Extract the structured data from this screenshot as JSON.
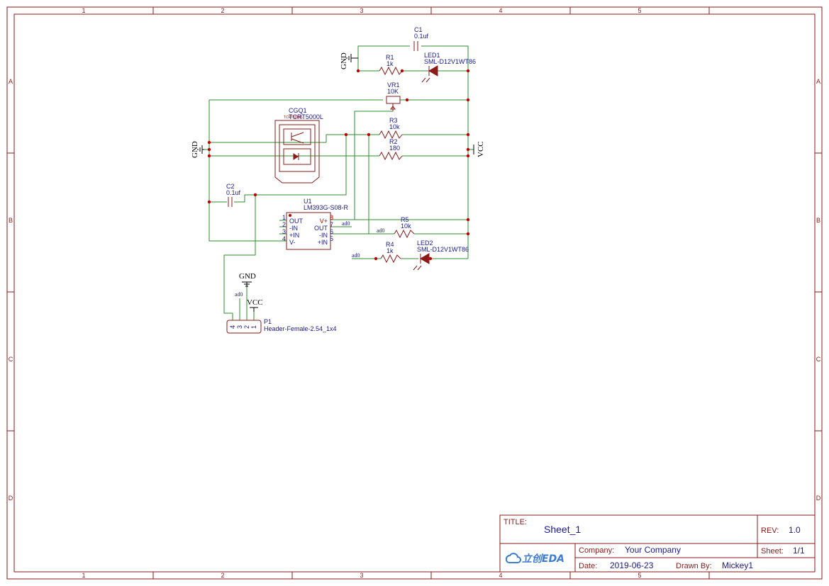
{
  "frame": {
    "columns": [
      "1",
      "2",
      "3",
      "4",
      "5"
    ],
    "rows": [
      "A",
      "B",
      "C",
      "D"
    ]
  },
  "components": {
    "c1": {
      "ref": "C1",
      "value": "0.1uf"
    },
    "r1": {
      "ref": "R1",
      "value": "1k"
    },
    "led1": {
      "ref": "LED1",
      "value": "SML-D12V1WT86"
    },
    "vr1": {
      "ref": "VR1",
      "value": "10K"
    },
    "cgq1": {
      "ref": "CGQ1",
      "value": "TCRT5000L",
      "sub": "TCRT5000L"
    },
    "r3": {
      "ref": "R3",
      "value": "10k"
    },
    "r2": {
      "ref": "R2",
      "value": "180"
    },
    "c2": {
      "ref": "C2",
      "value": "0.1uf"
    },
    "u1": {
      "ref": "U1",
      "value": "LM393G-S08-R",
      "left_pins": [
        {
          "num": "1",
          "name": "OUT"
        },
        {
          "num": "2",
          "name": "-IN"
        },
        {
          "num": "3",
          "name": "+IN"
        },
        {
          "num": "4",
          "name": "V-"
        }
      ],
      "right_pins": [
        {
          "num": "8",
          "name": "V+"
        },
        {
          "num": "7",
          "name": "OUT"
        },
        {
          "num": "6",
          "name": "-IN"
        },
        {
          "num": "5",
          "name": "+IN"
        }
      ]
    },
    "r5": {
      "ref": "R5",
      "value": "10k"
    },
    "r4": {
      "ref": "R4",
      "value": "1k"
    },
    "led2": {
      "ref": "LED2",
      "value": "SML-D12V1WT86"
    },
    "p1": {
      "ref": "P1",
      "value": "Header-Female-2.54_1x4",
      "pins": [
        "4",
        "3",
        "2",
        "1"
      ]
    }
  },
  "power": {
    "gnd": "GND",
    "vcc": "VCC"
  },
  "nets": {
    "ad0": "ad0"
  },
  "title_block": {
    "title_label": "TITLE:",
    "title": "Sheet_1",
    "rev_label": "REV:",
    "rev": "1.0",
    "company_label": "Company:",
    "company": "Your Company",
    "sheet_label": "Sheet:",
    "sheet": "1/1",
    "date_label": "Date:",
    "date": "2019-06-23",
    "drawn_label": "Drawn By:",
    "drawn": "Mickey1",
    "logo": "立创EDA"
  }
}
